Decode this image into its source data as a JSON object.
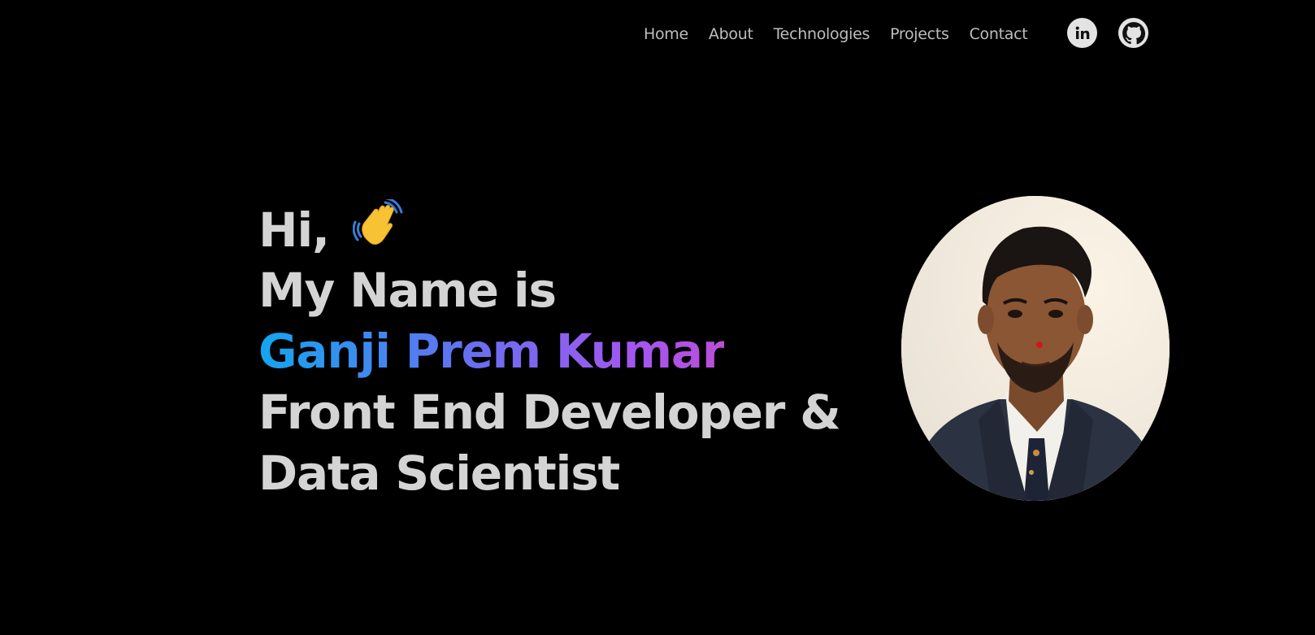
{
  "nav": {
    "links": [
      "Home",
      "About",
      "Technologies",
      "Projects",
      "Contact"
    ]
  },
  "social": {
    "linkedin_icon": "linkedin-icon",
    "github_icon": "github-icon"
  },
  "hero": {
    "greeting": "Hi,",
    "wave_icon": "waving-hand-icon",
    "intro": "My Name is",
    "name": "Ganji Prem Kumar",
    "role_line1": "Front End Developer &",
    "role_line2": "Data Scientist"
  },
  "colors": {
    "background": "#000000",
    "text": "#d4d4d4",
    "gradient_start": "#13a6f0",
    "gradient_end": "#b94fd8"
  }
}
